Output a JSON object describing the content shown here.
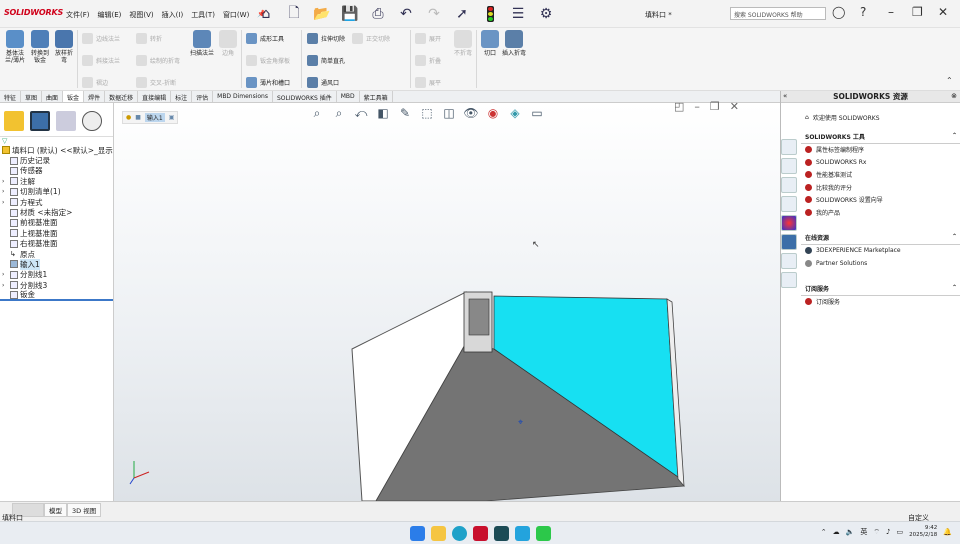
{
  "app": {
    "logo": "SOLIDWORKS",
    "doc_title": "填料口 *",
    "search_placeholder": "搜索 SOLIDWORKS 帮助"
  },
  "menus": [
    "文件(F)",
    "编辑(E)",
    "视图(V)",
    "插入(I)",
    "工具(T)",
    "窗口(W)"
  ],
  "ribbon": {
    "big": [
      "基体法兰/薄片",
      "转换到钣金",
      "放样折弯",
      "扫描法兰",
      "切口",
      "插入折弯"
    ],
    "disabled_small": [
      "边线法兰",
      "斜接法兰",
      "褶边",
      "绘制的折弯",
      "交叉-折断",
      "转折",
      "成形工具",
      "钣金角撑板",
      "展开",
      "不折弯",
      "折叠",
      "展平",
      "正交切除",
      "边角"
    ],
    "small": [
      "成形工具",
      "拉伸切除",
      "简单直孔",
      "通风口",
      "薄片和槽口"
    ]
  },
  "tabs": [
    "特征",
    "草图",
    "曲面",
    "钣金",
    "焊件",
    "数据迁移",
    "直接编辑",
    "标注",
    "评估",
    "MBD Dimensions",
    "SOLIDWORKS 插件",
    "MBD",
    "紫工具箱"
  ],
  "active_tab": "钣金",
  "tree": {
    "root": "填料口 (默认) <<默认>_显示",
    "items": [
      "历史记录",
      "传感器",
      "注解",
      "切割清单(1)",
      "方程式",
      "材质 <未指定>",
      "前视基准面",
      "上视基准面",
      "右视基准面",
      "原点",
      "输入1",
      "分割线1",
      "分割线3",
      "钣金"
    ],
    "selected": "输入1"
  },
  "viewport": {
    "breadcrumb": "输入1"
  },
  "resources": {
    "title": "SOLIDWORKS 资源",
    "welcome": "欢迎使用 SOLIDWORKS",
    "tools_title": "SOLIDWORKS 工具",
    "tools": [
      "属性标签编制程序",
      "SOLIDWORKS Rx",
      "性能基准测试",
      "比较我的评分",
      "SOLIDWORKS 设置向导",
      "我的产品"
    ],
    "community_title": "在线资源",
    "community": [
      "3DEXPERIENCE Marketplace",
      "Partner Solutions"
    ],
    "subscription_title": "订阅服务",
    "subscription": [
      "订阅服务"
    ]
  },
  "statusbar": {
    "tabs": [
      "模型",
      "3D 视图"
    ],
    "left_text": "填料口",
    "right_text": "自定义"
  },
  "taskbar": {
    "time": "9:42",
    "date": "2025/2/18",
    "ime": "英"
  },
  "colors": {
    "accent_face": "#17e0f2",
    "dark_face": "#707070",
    "brand": "#d0021b"
  }
}
